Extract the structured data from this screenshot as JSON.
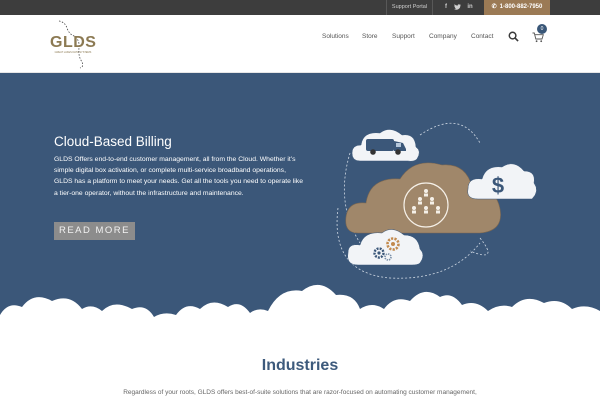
{
  "topbar": {
    "support_portal": "Support Portal",
    "social_icons": [
      "facebook-icon",
      "twitter-icon",
      "linkedin-icon"
    ],
    "phone": "1-800-882-7950"
  },
  "header": {
    "logo_text": "GLDS",
    "logo_subtext": "GREAT LAKES DATA SYSTEMS",
    "nav": [
      "Solutions",
      "Store",
      "Support",
      "Company",
      "Contact"
    ],
    "cart_count": "0"
  },
  "hero": {
    "title": "Cloud-Based Billing",
    "body": "GLDS Offers end-to-end customer management, all from the Cloud. Whether it’s simple digital box activation, or complete multi-service broadband operations, GLDS has a platform to meet your needs. Get all the tools you need to operate like a tier-one operator, without the infrastructure and maintenance.",
    "cta": "READ MORE",
    "illustration_icons": [
      "van-icon",
      "dollar-icon",
      "people-icon",
      "gears-icon"
    ]
  },
  "industries": {
    "title": "Industries",
    "text": "Regardless of your roots, GLDS offers best-of-suite solutions that are razor-focused on automating customer management,"
  },
  "colors": {
    "hero_bg": "#3b5779",
    "accent_brown": "#9b7a55",
    "heading_blue": "#3d5a7c",
    "topbar_bg": "#3d3d3d"
  }
}
